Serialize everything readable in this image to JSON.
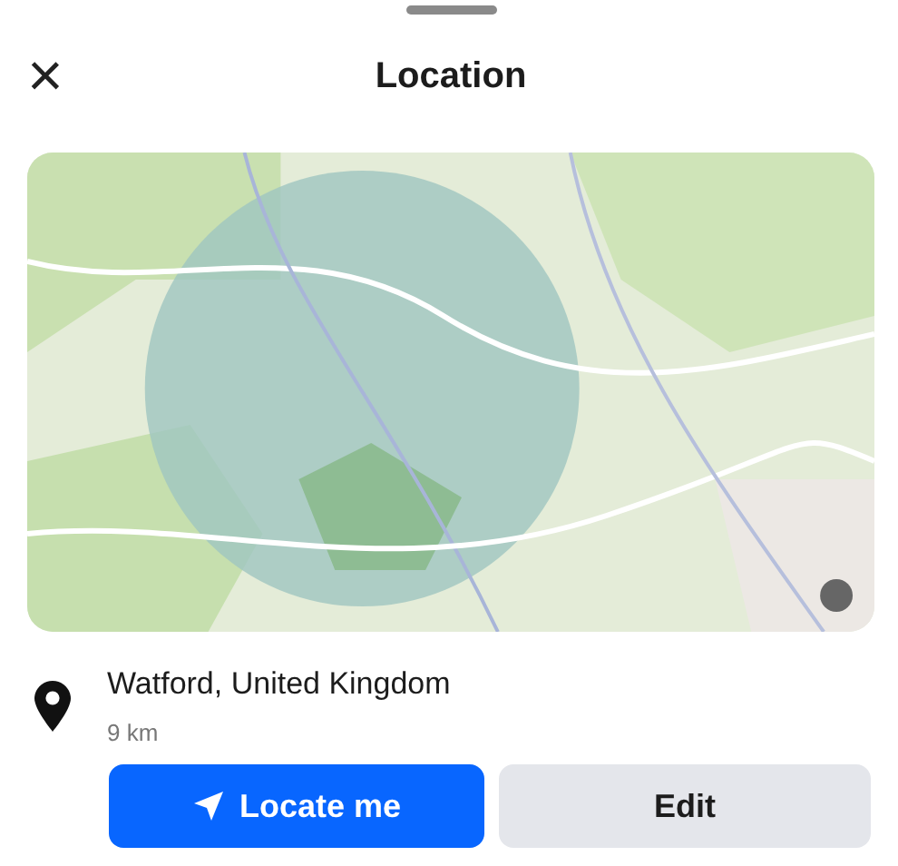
{
  "header": {
    "title": "Location",
    "close": "×"
  },
  "place": {
    "name": "Watford, United Kingdom",
    "radius": "9 km"
  },
  "buttons": [
    {
      "label": "Locate me",
      "kind": "primary"
    },
    {
      "label": "Edit",
      "kind": "secondary"
    }
  ]
}
